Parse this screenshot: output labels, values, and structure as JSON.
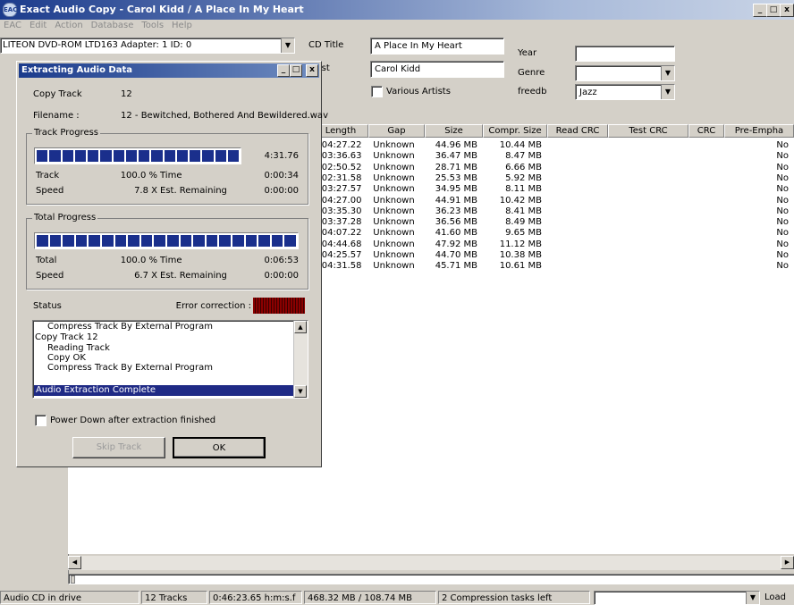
{
  "window": {
    "title": "Exact Audio Copy   -   Carol Kidd / A Place In My Heart",
    "app_icon": "eac-icon",
    "controls": [
      "_",
      "□",
      "x"
    ]
  },
  "menu": [
    "EAC",
    "Edit",
    "Action",
    "Database",
    "Tools",
    "Help"
  ],
  "drive": {
    "selected": "LITEON  DVD-ROM LTD163  Adapter: 1  ID: 0"
  },
  "cd_info": {
    "cd_title_label": "CD Title",
    "cd_title": "A Place In My Heart",
    "artist_label": "Artist",
    "artist": "Carol Kidd",
    "various_artists_label": "Various Artists",
    "year_label": "Year",
    "year": "",
    "genre_label": "Genre",
    "genre": "",
    "freedb_label": "freedb",
    "freedb": "Jazz"
  },
  "table": {
    "columns": [
      "Length",
      "Gap",
      "Size",
      "Compr. Size",
      "Read CRC",
      "Test CRC",
      "CRC",
      "Pre-Empha"
    ],
    "rows": [
      [
        "0:04:27.22",
        "Unknown",
        "44.96 MB",
        "10.44 MB",
        "",
        "",
        "",
        "No"
      ],
      [
        "0:03:36.63",
        "Unknown",
        "36.47 MB",
        "8.47 MB",
        "",
        "",
        "",
        "No"
      ],
      [
        "0:02:50.52",
        "Unknown",
        "28.71 MB",
        "6.66 MB",
        "",
        "",
        "",
        "No"
      ],
      [
        "0:02:31.58",
        "Unknown",
        "25.53 MB",
        "5.92 MB",
        "",
        "",
        "",
        "No"
      ],
      [
        "0:03:27.57",
        "Unknown",
        "34.95 MB",
        "8.11 MB",
        "",
        "",
        "",
        "No"
      ],
      [
        "0:04:27.00",
        "Unknown",
        "44.91 MB",
        "10.42 MB",
        "",
        "",
        "",
        "No"
      ],
      [
        "0:03:35.30",
        "Unknown",
        "36.23 MB",
        "8.41 MB",
        "",
        "",
        "",
        "No"
      ],
      [
        "0:03:37.28",
        "Unknown",
        "36.56 MB",
        "8.49 MB",
        "",
        "",
        "",
        "No"
      ],
      [
        "0:04:07.22",
        "Unknown",
        "41.60 MB",
        "9.65 MB",
        "",
        "",
        "",
        "No"
      ],
      [
        "0:04:44.68",
        "Unknown",
        "47.92 MB",
        "11.12 MB",
        "",
        "",
        "",
        "No"
      ],
      [
        "0:04:25.57",
        "Unknown",
        "44.70 MB",
        "10.38 MB",
        "",
        "",
        "",
        "No"
      ],
      [
        "0:04:31.58",
        "Unknown",
        "45.71 MB",
        "10.61 MB",
        "",
        "",
        "",
        "No"
      ]
    ]
  },
  "statusbar": {
    "cd_state": "Audio CD in drive",
    "tracks": "12 Tracks",
    "duration": "0:46:23.65 h:m:s.f",
    "sizes": "468.32 MB / 108.74 MB",
    "tasks": "2 Compression tasks left",
    "load": "Load"
  },
  "dialog": {
    "title": "Extracting Audio Data",
    "copy_track_label": "Copy Track",
    "copy_track": "12",
    "filename_label": "Filename :",
    "filename": "12 - Bewitched, Bothered And Bewildered.wav",
    "track_progress": {
      "title": "Track Progress",
      "fill": 1.0,
      "total_time": "4:31.76",
      "track_label": "Track",
      "track_pct": "100.0 %",
      "time_label": "Time",
      "time": "0:00:34",
      "speed_label": "Speed",
      "speed": "7.8 X",
      "remaining_label": "Est. Remaining",
      "remaining": "0:00:00"
    },
    "total_progress": {
      "title": "Total Progress",
      "fill": 1.0,
      "total_label": "Total",
      "total_pct": "100.0 %",
      "time_label": "Time",
      "time": "0:06:53",
      "speed_label": "Speed",
      "speed": "6.7 X",
      "remaining_label": "Est. Remaining",
      "remaining": "0:00:00"
    },
    "status_label": "Status",
    "error_correction_label": "Error correction :",
    "log": [
      "Compress Track By External Program",
      "Copy Track 12",
      "Reading Track",
      "Copy OK",
      "Compress Track By External Program"
    ],
    "log_selected": "Audio Extraction Complete",
    "power_down_label": "Power Down after extraction finished",
    "skip_label": "Skip Track",
    "ok_label": "OK",
    "accent": "#1a2f8c"
  }
}
